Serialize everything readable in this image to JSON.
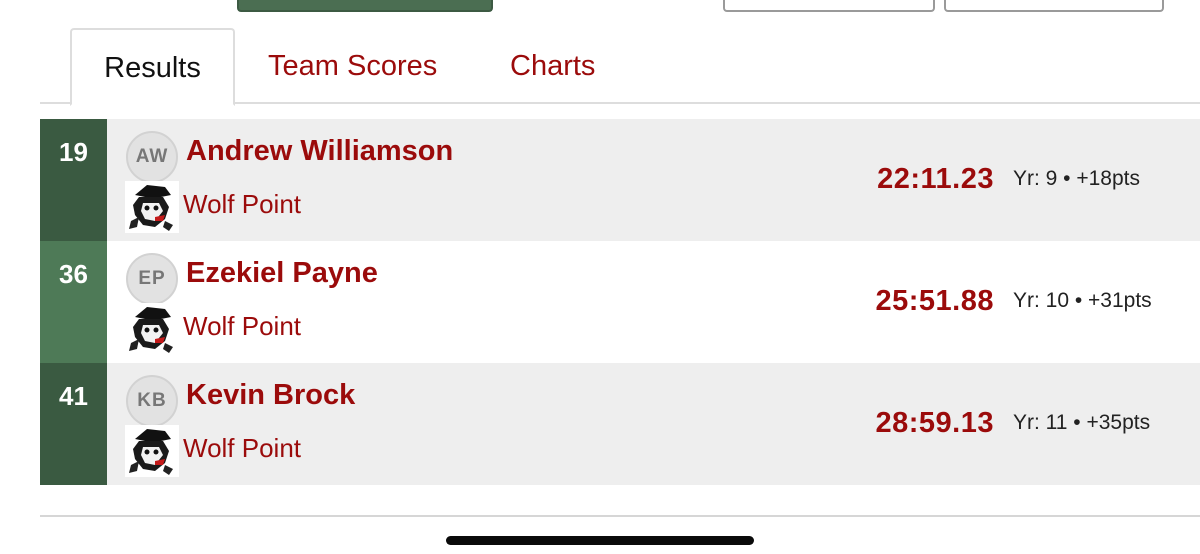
{
  "tabs": [
    {
      "label": "Results",
      "active": true
    },
    {
      "label": "Team Scores",
      "active": false
    },
    {
      "label": "Charts",
      "active": false
    }
  ],
  "results": [
    {
      "place": "19",
      "initials": "AW",
      "name": "Andrew Williamson",
      "team": "Wolf Point",
      "time": "22:11.23",
      "meta": "Yr: 9 • +18pts"
    },
    {
      "place": "36",
      "initials": "EP",
      "name": "Ezekiel Payne",
      "team": "Wolf Point",
      "time": "25:51.88",
      "meta": "Yr: 10 • +31pts"
    },
    {
      "place": "41",
      "initials": "KB",
      "name": "Kevin Brock",
      "team": "Wolf Point",
      "time": "28:59.13",
      "meta": "Yr: 11 • +35pts"
    }
  ],
  "icons": {
    "team_logo": "wolf-mascot-icon"
  },
  "colors": {
    "accent_red": "#9b0b0b",
    "place_green_dark": "#3a5a41",
    "place_green_light": "#4e7a57",
    "row_shade": "#eeeeee"
  }
}
